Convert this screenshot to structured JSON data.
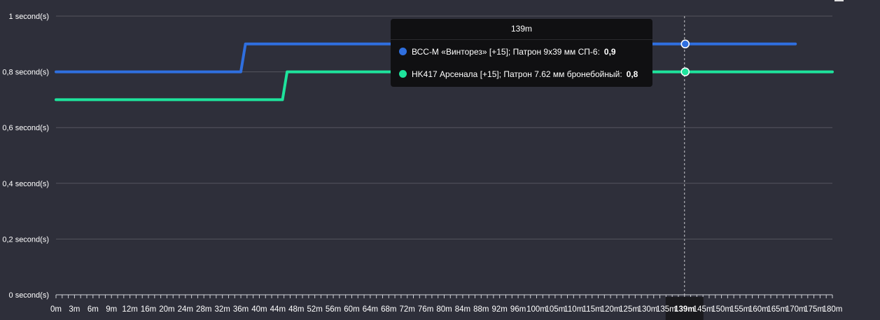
{
  "chart_data": {
    "type": "line",
    "x_ticks": [
      "0m",
      "3m",
      "6m",
      "9m",
      "12m",
      "16m",
      "20m",
      "24m",
      "28m",
      "32m",
      "36m",
      "40m",
      "44m",
      "48m",
      "52m",
      "56m",
      "60m",
      "64m",
      "68m",
      "72m",
      "76m",
      "80m",
      "84m",
      "88m",
      "92m",
      "96m",
      "100m",
      "105m",
      "110m",
      "115m",
      "120m",
      "125m",
      "130m",
      "135m",
      "139m",
      "145m",
      "150m",
      "155m",
      "160m",
      "165m",
      "170m",
      "175m",
      "180m"
    ],
    "y_ticks": [
      "0 second(s)",
      "0,2 second(s)",
      "0,4 second(s)",
      "0,6 second(s)",
      "0,8 second(s)",
      "1 second(s)"
    ],
    "y_values": [
      0,
      0.2,
      0.4,
      0.6,
      0.8,
      1
    ],
    "ylim": [
      0,
      1
    ],
    "grid": true,
    "series": [
      {
        "name": "ВСС-М «Винторез» [+15]; Патрон 9x39 мм СП-6:",
        "color": "#2f6fdf",
        "x": [
          "0m",
          "36m",
          "37m",
          "170m"
        ],
        "values": [
          0.8,
          0.8,
          0.9,
          0.9
        ]
      },
      {
        "name": "HK417 Арсенала [+15]; Патрон 7.62 мм бронебойный:",
        "color": "#1ee39c",
        "x": [
          "0m",
          "45m",
          "46m",
          "180m"
        ],
        "values": [
          0.7,
          0.7,
          0.8,
          0.8
        ]
      }
    ],
    "highlight_x": "139m",
    "tooltip": {
      "title": "139m",
      "rows": [
        {
          "label": "ВСС-М «Винторез» [+15]; Патрон 9x39 мм СП-6:",
          "value": "0,9",
          "color": "#2f6fdf"
        },
        {
          "label": "HK417 Арсенала [+15]; Патрон 7.62 мм бронебойный:",
          "value": "0,8",
          "color": "#1ee39c"
        }
      ]
    }
  }
}
